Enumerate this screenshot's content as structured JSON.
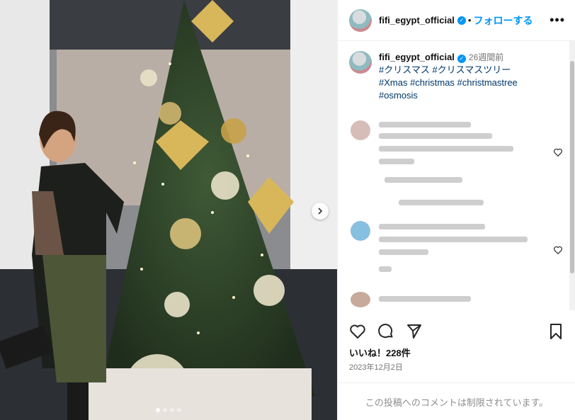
{
  "header": {
    "username": "fifi_egypt_official",
    "separator": "•",
    "follow_label": "フォローする",
    "more_icon": "more-horizontal-icon"
  },
  "caption": {
    "username": "fifi_egypt_official",
    "time_ago": "26週間前",
    "line1": "#クリスマス #クリスマスツリー",
    "line2": "#Xmas #christmas #christmastree",
    "line3": "#osmosis"
  },
  "actions": {
    "like_icon": "heart-icon",
    "comment_icon": "comment-icon",
    "share_icon": "share-icon",
    "save_icon": "bookmark-icon"
  },
  "likes_text": "いいね！228件",
  "date_text": "2023年12月2日",
  "restricted_text": "この投稿へのコメントは制限されています。",
  "carousel": {
    "slide_count": 4,
    "active_index": 0
  },
  "colors": {
    "accent": "#0095f6",
    "hashtag": "#00376b",
    "muted": "#737373"
  }
}
